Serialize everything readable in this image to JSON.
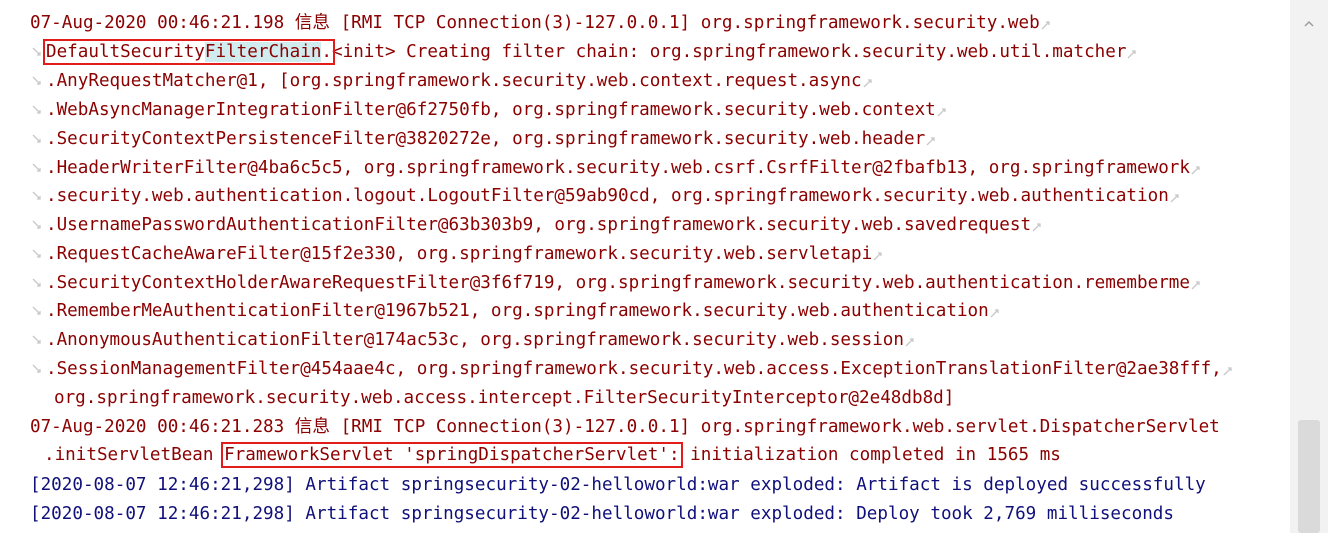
{
  "colors": {
    "log_red": "#8b0000",
    "log_blue": "#10107a",
    "box": "#e21b1b",
    "highlight": "#d0ecef"
  },
  "icons": {
    "soft_wrap": "wrap-arrow-icon"
  },
  "top_partial": "  . . . . . . . . . . . . . . . . . . . . . .",
  "log": {
    "l1": "07-Aug-2020 00:46:21.198 信息 [RMI TCP Connection(3)-127.0.0.1] org.springframework.security.web",
    "l2_box_a": "DefaultSecurity",
    "l2_box_hl": "FilterChain",
    "l2_box_b": ".",
    "l2_rest": "<init> Creating filter chain: org.springframework.security.web.util.matcher",
    "l3": ".AnyRequestMatcher@1, [org.springframework.security.web.context.request.async",
    "l4": ".WebAsyncManagerIntegrationFilter@6f2750fb, org.springframework.security.web.context",
    "l5": ".SecurityContextPersistenceFilter@3820272e, org.springframework.security.web.header",
    "l6": ".HeaderWriterFilter@4ba6c5c5, org.springframework.security.web.csrf.CsrfFilter@2fbafb13, org.springframework",
    "l7": ".security.web.authentication.logout.LogoutFilter@59ab90cd, org.springframework.security.web.authentication",
    "l8": ".UsernamePasswordAuthenticationFilter@63b303b9, org.springframework.security.web.savedrequest",
    "l9": ".RequestCacheAwareFilter@15f2e330, org.springframework.security.web.servletapi",
    "l10": ".SecurityContextHolderAwareRequestFilter@3f6f719, org.springframework.security.web.authentication.rememberme",
    "l11": ".RememberMeAuthenticationFilter@1967b521, org.springframework.security.web.authentication",
    "l12": ".AnonymousAuthenticationFilter@174ac53c, org.springframework.security.web.session",
    "l13": ".SessionManagementFilter@454aae4c, org.springframework.security.web.access.ExceptionTranslationFilter@2ae38fff,",
    "l14": "org.springframework.security.web.access.intercept.FilterSecurityInterceptor@2e48db8d]",
    "l15": "07-Aug-2020 00:46:21.283 信息 [RMI TCP Connection(3)-127.0.0.1] org.springframework.web.servlet.DispatcherServlet",
    "l16_pre": ".initServletBean ",
    "l16_box": "FrameworkServlet 'springDispatcherServlet':",
    "l16_rest": " initialization completed in 1565 ms",
    "l17": "[2020-08-07 12:46:21,298] Artifact springsecurity-02-helloworld:war exploded: Artifact is deployed successfully",
    "l18": "[2020-08-07 12:46:21,298] Artifact springsecurity-02-helloworld:war exploded: Deploy took 2,769 milliseconds"
  }
}
